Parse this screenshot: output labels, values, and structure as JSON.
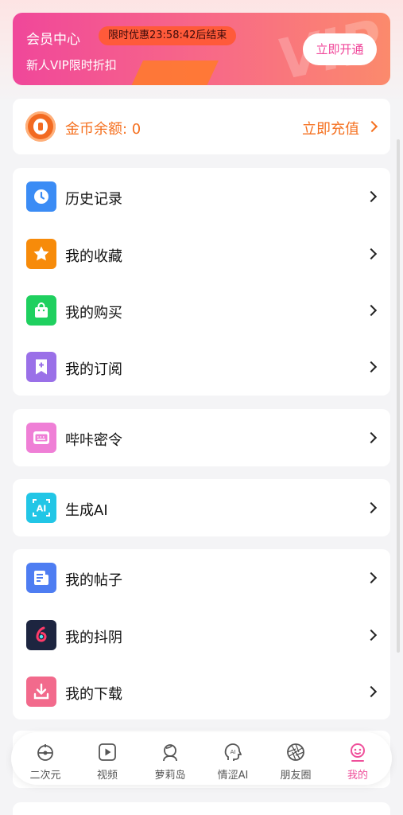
{
  "vip": {
    "title": "会员中心",
    "countdown": "限时优惠23:58:42后结束",
    "subtitle": "新人VIP限时折扣",
    "open_label": "立即开通"
  },
  "coins": {
    "balance_label": "金币余额: 0",
    "recharge_label": "立即充值"
  },
  "menu_group_1": [
    {
      "label": "历史记录",
      "icon": "history-icon",
      "color": "#3b8cf5"
    },
    {
      "label": "我的收藏",
      "icon": "star-icon",
      "color": "#f78b0a"
    },
    {
      "label": "我的购买",
      "icon": "shopping-bag-icon",
      "color": "#1fd05f"
    },
    {
      "label": "我的订阅",
      "icon": "bookmark-icon",
      "color": "#9a70e8"
    }
  ],
  "menu_group_2": [
    {
      "label": "哔咔密令",
      "icon": "keyboard-icon",
      "color": "#ef7fd6"
    }
  ],
  "menu_group_3": [
    {
      "label": "生成AI",
      "icon": "ai-icon",
      "color": "#22c6e6"
    }
  ],
  "menu_group_4": [
    {
      "label": "我的帖子",
      "icon": "post-icon",
      "color": "#4e7df2"
    },
    {
      "label": "我的抖阴",
      "icon": "tiktok-icon",
      "color": "#1d2540"
    },
    {
      "label": "我的下载",
      "icon": "download-icon",
      "color": "#f26a8c"
    }
  ],
  "tabbar": [
    {
      "label": "二次元",
      "icon": "anime-icon",
      "active": false
    },
    {
      "label": "视频",
      "icon": "video-icon",
      "active": false
    },
    {
      "label": "萝莉岛",
      "icon": "girl-icon",
      "active": false
    },
    {
      "label": "情涩AI",
      "icon": "ai-head-icon",
      "active": false
    },
    {
      "label": "朋友圈",
      "icon": "aperture-icon",
      "active": false
    },
    {
      "label": "我的",
      "icon": "profile-icon",
      "active": true
    }
  ],
  "colors": {
    "accent": "#f5701f",
    "active_tab": "#ef4f9a"
  }
}
